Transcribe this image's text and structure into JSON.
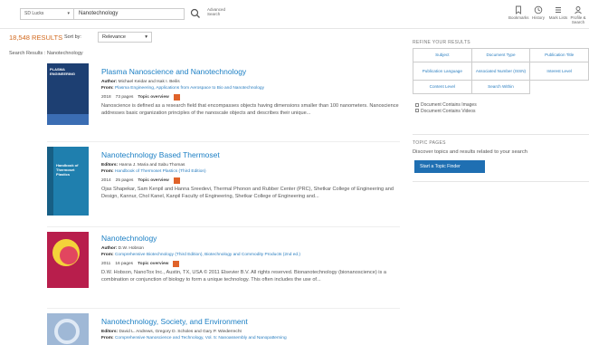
{
  "topbar": {
    "scope": "SD Lucks",
    "query": "Nanotechnology",
    "advanced_search": "Advanced Search",
    "tools": [
      {
        "label": "Bookmarks",
        "icon": "bookmark-icon"
      },
      {
        "label": "History",
        "icon": "clock-icon"
      },
      {
        "label": "Mark Lists",
        "icon": "list-icon"
      },
      {
        "label": "Profile & Search",
        "icon": "user-icon"
      }
    ]
  },
  "results_bar": {
    "count": "18,548",
    "results_label": "RESULTS",
    "sort_label": "Sort by:",
    "sort_value": "Relevance",
    "breadcrumb": "Search Results : Nanotechnology"
  },
  "results": [
    {
      "title": "Plasma Nanoscience and Nanotechnology",
      "authors_label": "Author:",
      "authors": "Michael Keidar and Isak I. Beilis",
      "from_label": "From:",
      "source": "Plasma Engineering, Applications from Aerospace to Bio and Nanotechnology",
      "year": "2018",
      "pages": "73 pages",
      "topic_label": "Topic overview",
      "abstract": "Nanoscience is defined as a research field that encompasses objects having dimensions smaller than 100 nanometers. Nanoscience addresses basic organization principles of the nanoscale objects and describes their unique...",
      "cover_title": "PLASMA ENGINEERING",
      "cover_color": "#1d3f72"
    },
    {
      "title": "Nanotechnology Based Thermoset",
      "authors_label": "Editors:",
      "authors": "Hanna J. Maria and Sabu Thomas",
      "from_label": "From:",
      "source": "Handbook of Thermoset Plastics (Third Edition)",
      "year": "2014",
      "pages": "25 pages",
      "topic_label": "Topic overview",
      "abstract": "Ojas Shapekar, Sam Kenpil and Hanna Sreedevi, Thermal Phonon and Rubber Center (PRC), Shetkar College of Engineering and Design, Kannur, Chol Kanel, Kanpil Faculty of Engineering, Shetkar College of Engineering and...",
      "cover_title": "Handbook of Thermoset Plastics",
      "cover_color": "#1f7fae"
    },
    {
      "title": "Nanotechnology",
      "authors_label": "Author:",
      "authors": "D.W. Hobson",
      "from_label": "From:",
      "source": "Comprehensive Biotechnology (Third Edition), Biotechnology and Commodity Products (2nd ed.)",
      "year": "2011",
      "pages": "16 pages",
      "topic_label": "Topic overview",
      "abstract": "D.W. Hobson, NanoTox Inc., Austin, TX, USA © 2011 Elsevier B.V. All rights reserved. Bionanotechnology (bionanoscience) is a combination or conjunction of biology to form a unique technology. This often includes the use of...",
      "cover_title": "",
      "cover_color": "#b81e4c"
    },
    {
      "title": "Nanotechnology, Society, and Environment",
      "authors_label": "Editors:",
      "authors": "David L. Andrews, Gregory D. Scholes and Gary P. Wiederrecht",
      "from_label": "From:",
      "source": "Comprehensive Nanoscience and Technology, Vol. 5: Nanoassembly and Nanopatterning",
      "year": "",
      "pages": "",
      "topic_label": "",
      "abstract": "",
      "cover_title": "",
      "cover_color": "#9fb8d6"
    }
  ],
  "refine": {
    "title": "REFINE YOUR RESULTS",
    "options": [
      "Subject",
      "Document Type",
      "Publication Title",
      "Publication Language",
      "Associated Number (ISSN)",
      "Interest Level",
      "Content Level",
      "Search Within"
    ],
    "checks": [
      "Document Contains Images",
      "Document Contains Videos"
    ]
  },
  "topic": {
    "title": "TOPIC PAGES",
    "description": "Discover topics and results related to your search",
    "button": "Start a Topic Finder"
  },
  "colors": {
    "accent_orange": "#d2691e",
    "link_blue": "#1b7fc4",
    "button_blue": "#1f6fb2"
  }
}
